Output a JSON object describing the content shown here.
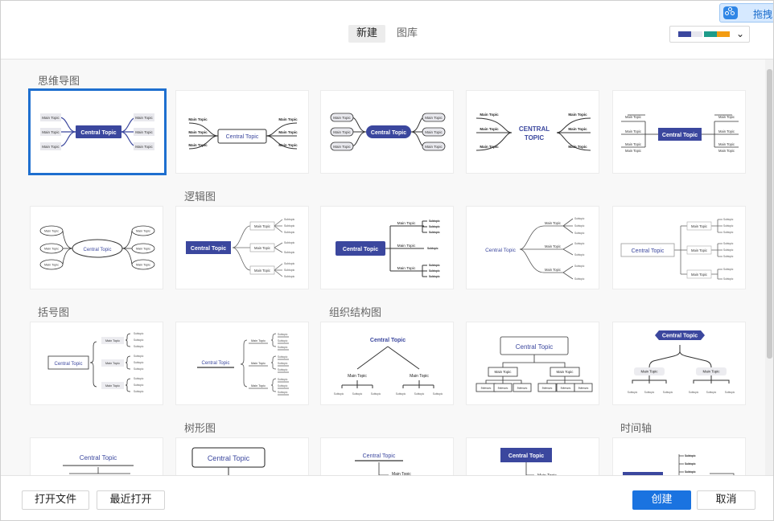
{
  "header": {
    "tabs": [
      {
        "label": "新建",
        "active": true
      },
      {
        "label": "图库",
        "active": false
      }
    ],
    "helper_label": "拖拽",
    "theme_colors": [
      "#3b479e",
      "#e6e6ee",
      "#1e9b8a",
      "#f39c12"
    ]
  },
  "categories": {
    "mindmap": "思维导图",
    "logic": "逻辑图",
    "brace": "括号图",
    "org": "组织结构图",
    "tree": "树形图",
    "timeline": "时间轴"
  },
  "card_text": {
    "central_topic": "Central Topic",
    "central_topic_caps": "CENTRAL TOPIC",
    "main_topic": "Main Topic",
    "main_topic_short": "Main Topic",
    "subtopic": "Subtopic"
  },
  "footer": {
    "open_file": "打开文件",
    "recent": "最近打开",
    "create": "创建",
    "cancel": "取消"
  },
  "colors": {
    "accent": "#1a73e0",
    "navy": "#3b479e",
    "selected_border": "#1e6fcf"
  }
}
